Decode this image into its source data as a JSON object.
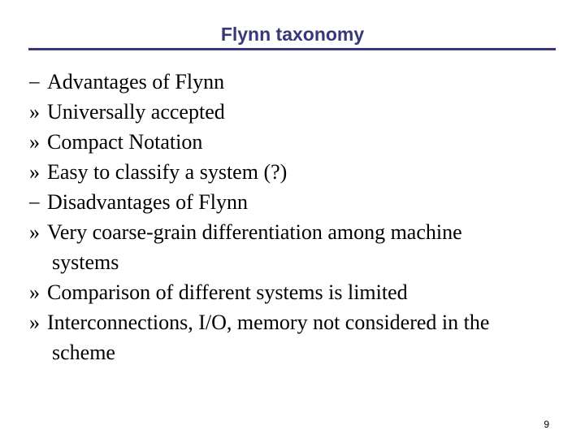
{
  "slide": {
    "title": "Flynn taxonomy",
    "title_color": "#383878",
    "rule_color": "#383878",
    "background_color": "#ffffff",
    "text_color": "#000000",
    "page_number": "9",
    "bullets": [
      {
        "marker": "–",
        "level": 1,
        "text": "Advantages of Flynn",
        "continuation": ""
      },
      {
        "marker": "»",
        "level": 2,
        "text": "Universally accepted",
        "continuation": ""
      },
      {
        "marker": "»",
        "level": 2,
        "text": "Compact Notation",
        "continuation": ""
      },
      {
        "marker": "»",
        "level": 2,
        "text": "Easy to classify a system (?)",
        "continuation": ""
      },
      {
        "marker": "–",
        "level": 1,
        "text": "Disadvantages of Flynn",
        "continuation": ""
      },
      {
        "marker": "»",
        "level": 2,
        "text": "Very coarse-grain differentiation among machine",
        "continuation": "systems"
      },
      {
        "marker": "»",
        "level": 2,
        "text": "Comparison of different systems is limited",
        "continuation": ""
      },
      {
        "marker": "»",
        "level": 2,
        "text": "Interconnections, I/O, memory not considered in the",
        "continuation": "scheme"
      }
    ]
  }
}
